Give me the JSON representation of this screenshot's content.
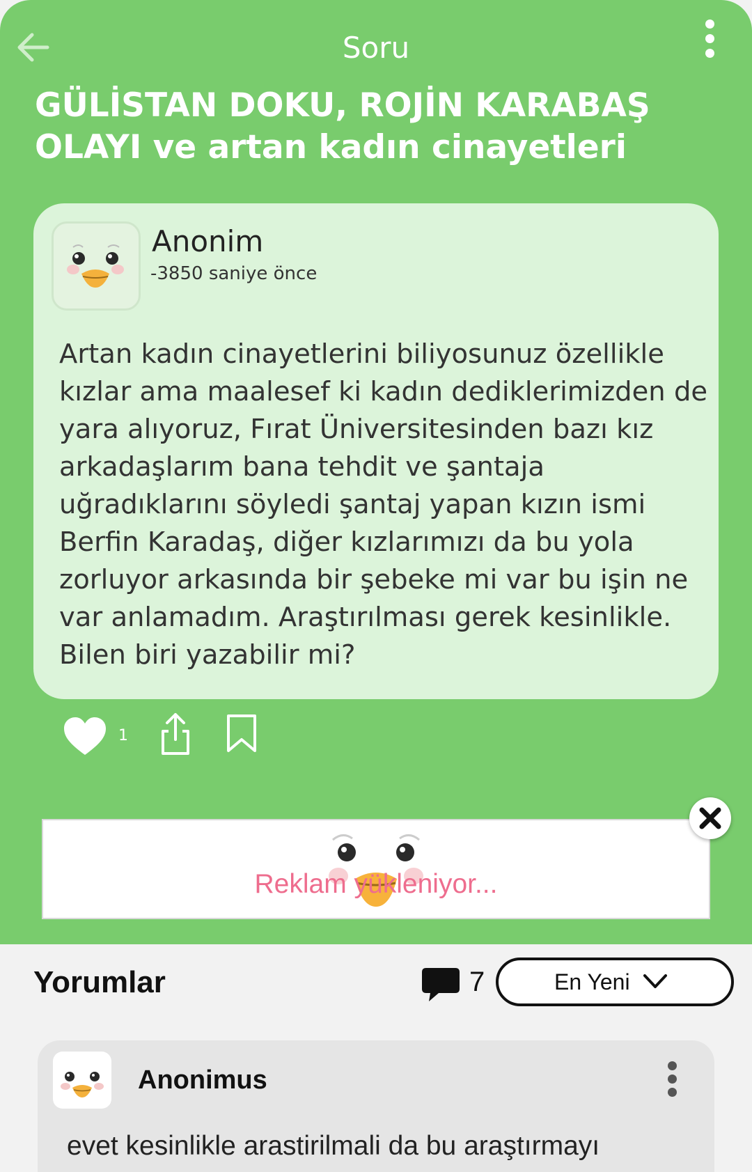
{
  "header": {
    "title": "Soru",
    "back_icon": "arrow-left-icon",
    "more_icon": "more-vertical-icon"
  },
  "question": {
    "title": "GÜLİSTAN DOKU, ROJİN KARABAŞ OLAYI ve artan kadın cinayetleri",
    "author": "Anonim",
    "time": "-3850 saniye önce",
    "body": "Artan kadın cinayetlerini biliyosunuz özellikle kızlar ama maalesef ki kadın dediklerimizden de yara alıyoruz, Fırat Üniversitesinden bazı kız arkadaşlarım bana tehdit ve şantaja uğradıklarını söyledi şantaj yapan kızın ismi Berfin Karadaş, diğer kızlarımızı da bu yola zorluyor arkasında bir şebeke mi var bu işin ne var anlamadım. Araştırılması gerek kesinlikle. Bilen biri yazabilir mi?",
    "avatar_icon": "duck-avatar-icon"
  },
  "actions": {
    "like_count": "1",
    "like_icon": "heart-icon",
    "share_icon": "share-icon",
    "bookmark_icon": "bookmark-icon"
  },
  "ad": {
    "text": "Reklam yükleniyor...",
    "close_icon": "close-icon"
  },
  "comments": {
    "title": "Yorumlar",
    "count": "7",
    "count_icon": "comment-bubble-icon",
    "sort_label": "En Yeni",
    "sort_icon": "chevron-down-icon",
    "items": [
      {
        "author": "Anonimus",
        "body": "evet kesinlikle arastirilmali da bu araştırmayı"
      }
    ]
  },
  "colors": {
    "brand_green": "#79cc6d",
    "card_green": "#dcf4da",
    "ad_pink": "#ee6d8e"
  }
}
